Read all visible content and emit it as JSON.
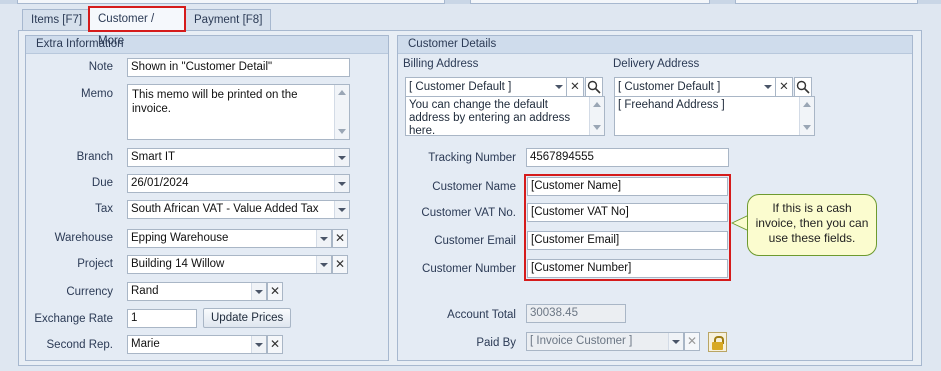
{
  "tabs": [
    {
      "label": "Items [F7]"
    },
    {
      "label": "Customer / More"
    },
    {
      "label": "Payment [F8]"
    }
  ],
  "extra_info": {
    "title": "Extra Information",
    "note": {
      "label": "Note",
      "value": "Shown in \"Customer Detail\""
    },
    "memo": {
      "label": "Memo",
      "value": "This memo will be printed on the invoice."
    },
    "branch": {
      "label": "Branch",
      "value": "Smart IT"
    },
    "due": {
      "label": "Due",
      "value": "26/01/2024"
    },
    "tax": {
      "label": "Tax",
      "value": "South African VAT - Value Added Tax"
    },
    "warehouse": {
      "label": "Warehouse",
      "value": "Epping Warehouse"
    },
    "project": {
      "label": "Project",
      "value": "Building 14 Willow"
    },
    "currency": {
      "label": "Currency",
      "value": "Rand"
    },
    "exchange_rate": {
      "label": "Exchange Rate",
      "value": "1",
      "button": "Update Prices"
    },
    "second_rep": {
      "label": "Second Rep.",
      "value": "Marie"
    }
  },
  "customer_details": {
    "title": "Customer Details",
    "billing": {
      "label": "Billing Address",
      "selected": "[ Customer Default ]",
      "text": "You can change the default address by entering an address here."
    },
    "delivery": {
      "label": "Delivery Address",
      "selected": "[ Customer Default ]",
      "text": "[ Freehand Address ]"
    },
    "tracking_number": {
      "label": "Tracking Number",
      "value": "4567894555"
    },
    "customer_name": {
      "label": "Customer Name",
      "value": "[Customer Name]"
    },
    "customer_vat": {
      "label": "Customer VAT No.",
      "value": "[Customer VAT No]"
    },
    "customer_email": {
      "label": "Customer Email",
      "value": "[Customer Email]"
    },
    "customer_number": {
      "label": "Customer Number",
      "value": "[Customer Number]"
    },
    "account_total": {
      "label": "Account Total",
      "value": "30038.45"
    },
    "paid_by": {
      "label": "Paid By",
      "placeholder": "[ Invoice Customer ]"
    }
  },
  "callout": {
    "text": "If this is a cash invoice, then you can use these fields."
  },
  "icons": {
    "clear": "close-icon",
    "search": "search-icon",
    "dropdown": "chevron-down-icon",
    "lock": "lock-icon"
  },
  "colors": {
    "highlight": "#d51b1b",
    "callout_bg": "#fbfccf",
    "callout_border": "#6d9a2f"
  }
}
